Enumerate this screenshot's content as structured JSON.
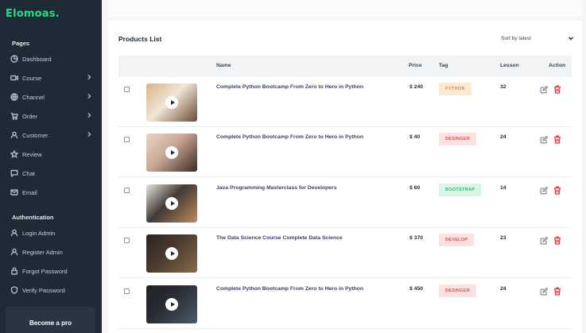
{
  "brand": {
    "logo": "Elomoas."
  },
  "sidebar": {
    "pages_title": "Pages",
    "items": [
      {
        "label": "Dashboard",
        "icon": "pie-chart-icon",
        "chevron": false
      },
      {
        "label": "Course",
        "icon": "video-icon",
        "chevron": true
      },
      {
        "label": "Channel",
        "icon": "globe-icon",
        "chevron": true
      },
      {
        "label": "Order",
        "icon": "cart-icon",
        "chevron": true
      },
      {
        "label": "Customer",
        "icon": "user-icon",
        "chevron": true
      },
      {
        "label": "Review",
        "icon": "star-icon",
        "chevron": false
      },
      {
        "label": "Chat",
        "icon": "chat-icon",
        "chevron": false
      },
      {
        "label": "Email",
        "icon": "mail-icon",
        "chevron": false
      }
    ],
    "auth_title": "Authentication",
    "auth_items": [
      {
        "label": "Login Admin",
        "icon": "user-icon"
      },
      {
        "label": "Register Admin",
        "icon": "user-icon"
      },
      {
        "label": "Forgot Password",
        "icon": "lock-icon"
      },
      {
        "label": "Verify Password",
        "icon": "shield-icon"
      }
    ],
    "pro_label": "Become a pro"
  },
  "products": {
    "title": "Products List",
    "sort_label": "Sort by latest",
    "columns": {
      "name": "Name",
      "price": "Price",
      "tag": "Tag",
      "lesson": "Lesson",
      "action": "Action"
    },
    "rows": [
      {
        "name": "Complete Python Bootcamp From Zero to Hero in Python",
        "price": "$ 240",
        "tag": "PYTHON",
        "tag_bg": "#fde8d2",
        "tag_color": "#e08a3c",
        "lesson": "32",
        "thumb": "thumb-workspace",
        "thumb_colors": [
          "#d9b28a",
          "#6b4a36",
          "#f1e6d6"
        ]
      },
      {
        "name": "Complete Python Bootcamp From Zero to Hero in Python",
        "price": "$ 40",
        "tag": "DESINGER",
        "tag_bg": "#fde1e1",
        "tag_color": "#e24b4b",
        "lesson": "24",
        "thumb": "thumb-woman-hat",
        "thumb_colors": [
          "#e9d7c9",
          "#3a2a24",
          "#c9a693"
        ]
      },
      {
        "name": "Java Programming Masterclass for Developers",
        "price": "$ 60",
        "tag": "BOOTSTRAP",
        "tag_bg": "#d8f6e6",
        "tag_color": "#2bb673",
        "lesson": "14",
        "thumb": "thumb-woman-desk",
        "thumb_colors": [
          "#e8e4df",
          "#c28a5a",
          "#3f3a36"
        ]
      },
      {
        "name": "The Data Science Course Complete Data Science",
        "price": "$ 370",
        "tag": "DEVELOP",
        "tag_bg": "#fde1e1",
        "tag_color": "#e24b4b",
        "lesson": "23",
        "thumb": "thumb-classroom",
        "thumb_colors": [
          "#2c2420",
          "#8a6a4a",
          "#4a3a2e"
        ]
      },
      {
        "name": "Complete Python Bootcamp From Zero to Hero in Python",
        "price": "$ 450",
        "tag": "DESINGER",
        "tag_bg": "#fde1e1",
        "tag_color": "#e24b4b",
        "lesson": "24",
        "thumb": "thumb-monitors",
        "thumb_colors": [
          "#1e2228",
          "#4a5a6a",
          "#2a2e34"
        ]
      }
    ]
  }
}
